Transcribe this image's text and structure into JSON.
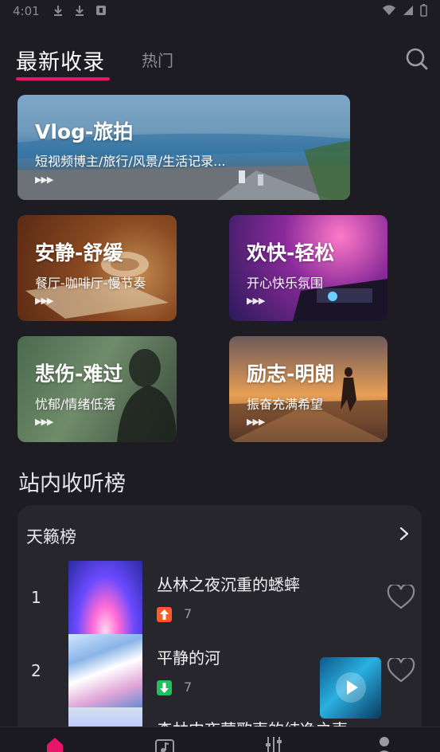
{
  "status_bar": {
    "time": "4:01"
  },
  "header": {
    "tab_active": "最新收录",
    "tab_inactive": "热门"
  },
  "categories": [
    {
      "title": "Vlog-旅拍",
      "subtitle": "短视频博主/旅行/风景/生活记录...",
      "play": "▶▶▶"
    },
    {
      "title": "安静-舒缓",
      "subtitle": "餐厅-咖啡厅-慢节奏",
      "play": "▶▶▶"
    },
    {
      "title": "欢快-轻松",
      "subtitle": "开心快乐氛围",
      "play": "▶▶▶"
    },
    {
      "title": "悲伤-难过",
      "subtitle": "忧郁/情绪低落",
      "play": "▶▶▶"
    },
    {
      "title": "励志-明朗",
      "subtitle": "振奋充满希望",
      "play": "▶▶▶"
    }
  ],
  "ranking": {
    "section_title": "站内收听榜",
    "chart_name": "天籁榜",
    "rows": [
      {
        "rank": "1",
        "title": "丛林之夜沉重的蟋蟀",
        "trend": "up",
        "count": "7"
      },
      {
        "rank": "2",
        "title": "平静的河",
        "trend": "down",
        "count": "7"
      },
      {
        "rank": "",
        "title": "森林中夜莺歌声的纯净之声",
        "trend": "",
        "count": ""
      }
    ]
  },
  "colors": {
    "accent": "#e8156b",
    "trend_up": "#ff5a2a",
    "trend_down": "#1fc25a",
    "background": "#1c1c22",
    "panel": "#26262c"
  },
  "icons": {
    "search": "search-icon",
    "arrow": "chevron-right-icon",
    "heart": "heart-outline-icon",
    "nav": [
      "home-icon",
      "music-icon",
      "mixer-icon",
      "profile-icon"
    ]
  }
}
